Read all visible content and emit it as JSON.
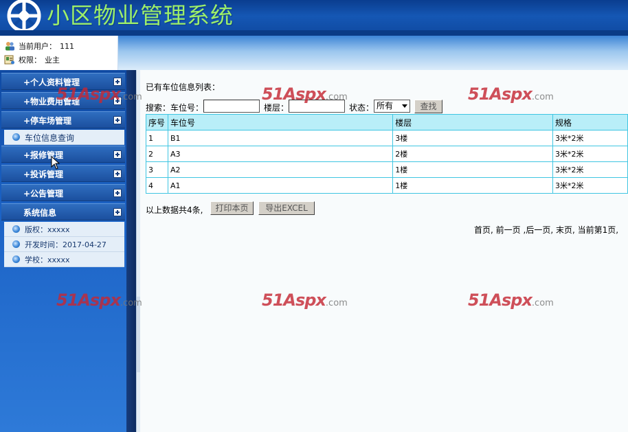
{
  "header": {
    "title": "小区物业管理系统"
  },
  "user": {
    "current_user_label": "当前用户：",
    "current_user_value": "111",
    "role_label": "权限：",
    "role_value": "业主"
  },
  "sidebar": {
    "menus": [
      {
        "label": "+个人资料管理"
      },
      {
        "label": "+物业费用管理"
      },
      {
        "label": "+停车场管理"
      },
      {
        "label": "+报修管理"
      },
      {
        "label": "+投诉管理"
      },
      {
        "label": "+公告管理"
      },
      {
        "label": "系统信息"
      }
    ],
    "parking_sub": [
      {
        "label": "车位信息查询"
      }
    ],
    "system_info": [
      {
        "label": "版权：xxxxx"
      },
      {
        "label": "开发时间：2017-04-27"
      },
      {
        "label": "学校：xxxxx"
      }
    ]
  },
  "main": {
    "list_title": "已有车位信息列表：",
    "search": {
      "search_label": "搜索：",
      "space_no_label": "车位号：",
      "space_no_value": "",
      "floor_label": "楼层：",
      "floor_value": "",
      "status_label": "状态：",
      "status_value": "所有",
      "find_button": "查找"
    },
    "table": {
      "columns": [
        "序号",
        "车位号",
        "楼层",
        "规格"
      ],
      "rows": [
        [
          "1",
          "B1",
          "3楼",
          "3米*2米"
        ],
        [
          "2",
          "A3",
          "2楼",
          "3米*2米"
        ],
        [
          "3",
          "A2",
          "1楼",
          "3米*2米"
        ],
        [
          "4",
          "A1",
          "1楼",
          "3米*2米"
        ]
      ]
    },
    "footer": {
      "total_text": "以上数据共4条,",
      "print_button": "打印本页",
      "export_button": "导出EXCEL"
    },
    "pager": {
      "first": "首页,",
      "prev": "前一页",
      "next": ",后一页,",
      "last": "末页,",
      "current": "当前第1页,"
    }
  },
  "watermark": {
    "brand": "51Aspx",
    "suffix": ".com"
  },
  "colors": {
    "header_bg": "#1557b4",
    "title_green": "#9dee6a",
    "table_border": "#3ec5e2",
    "table_header_bg": "#b9eef8",
    "watermark_red": "#c42834"
  }
}
